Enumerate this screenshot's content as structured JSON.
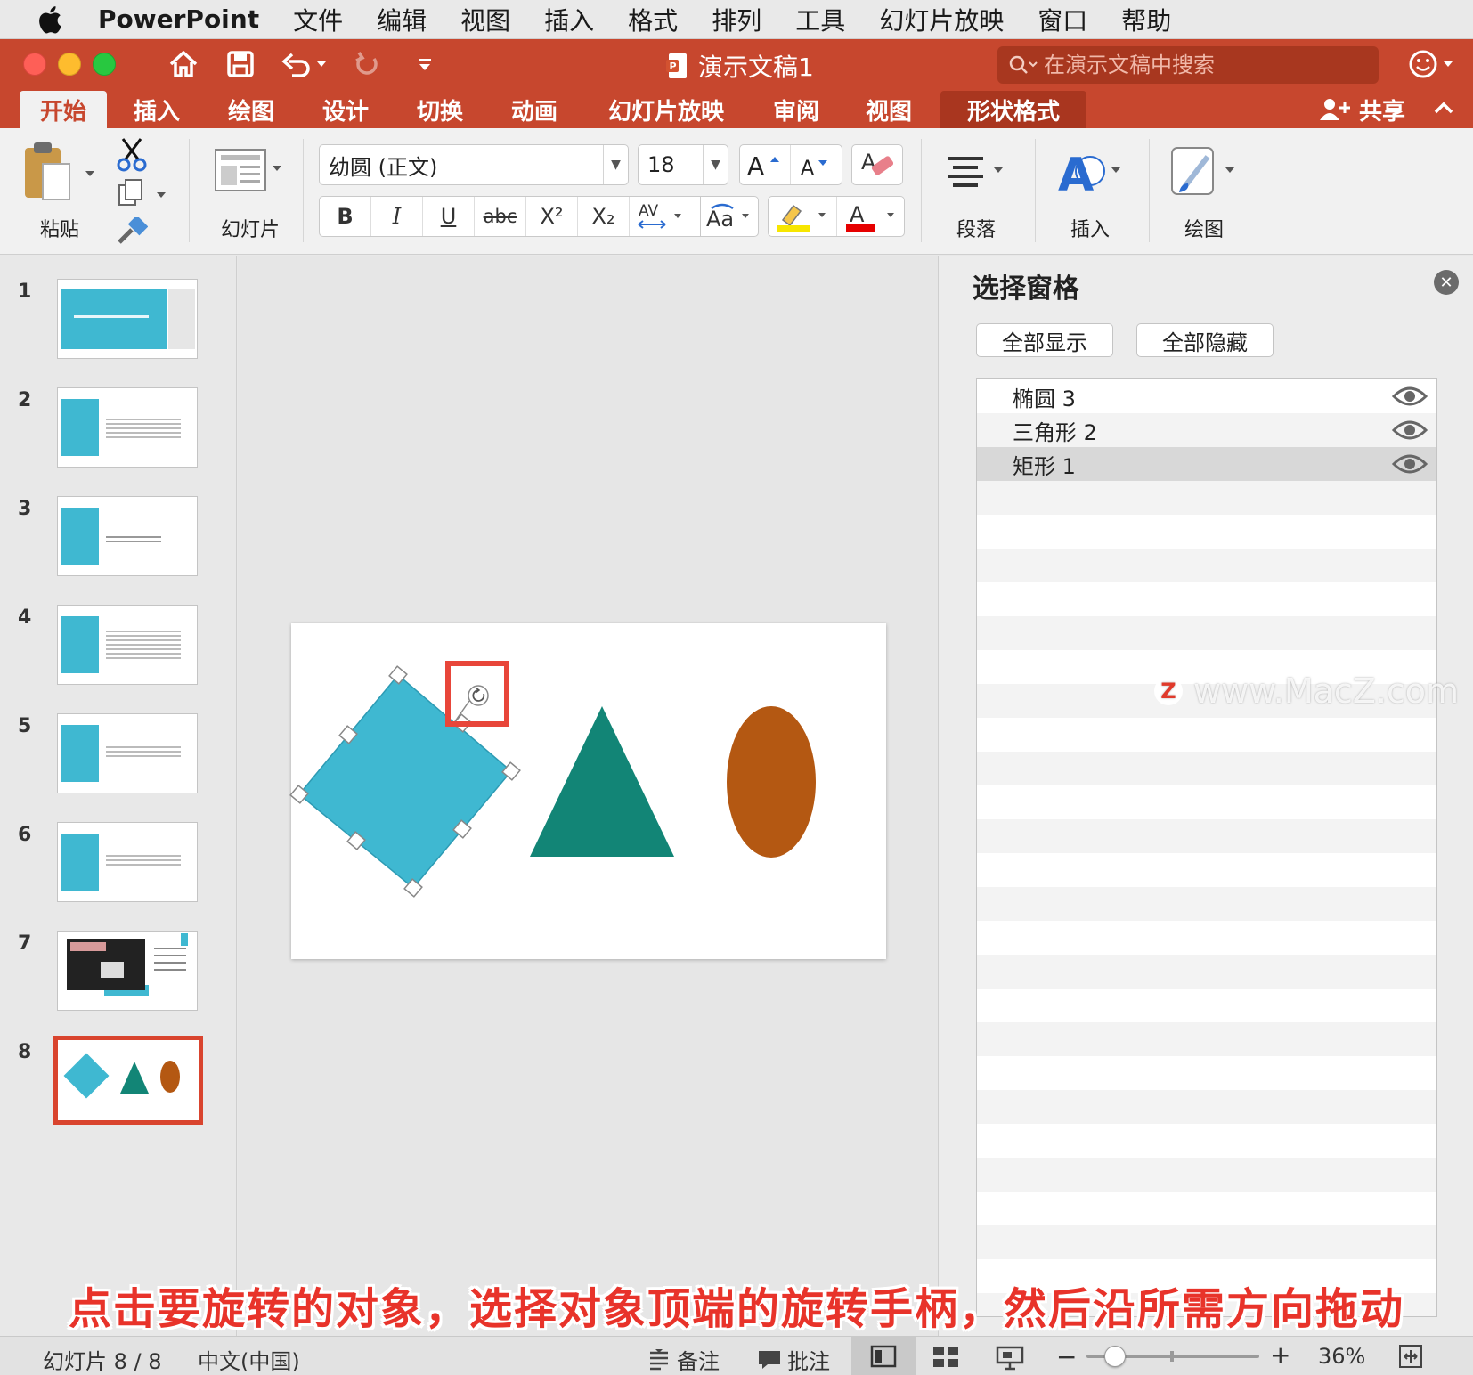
{
  "menubar": {
    "app": "PowerPoint",
    "items": [
      "文件",
      "编辑",
      "视图",
      "插入",
      "格式",
      "排列",
      "工具",
      "幻灯片放映",
      "窗口",
      "帮助"
    ]
  },
  "titlebar": {
    "doc_title": "演示文稿1",
    "search_placeholder": "在演示文稿中搜索"
  },
  "tabs": {
    "items": [
      "开始",
      "插入",
      "绘图",
      "设计",
      "切换",
      "动画",
      "幻灯片放映",
      "审阅",
      "视图",
      "形状格式"
    ],
    "active": "开始",
    "share_label": "共享"
  },
  "ribbon": {
    "paste_label": "粘贴",
    "slide_label": "幻灯片",
    "font_name": "幼圆 (正文)",
    "font_size": "18",
    "paragraph_label": "段落",
    "insert_label": "插入",
    "draw_label": "绘图",
    "format_buttons": [
      "B",
      "I",
      "U",
      "abc",
      "X²",
      "X₂"
    ],
    "colors": {
      "highlight": "#f7e600",
      "font_color": "#e60000",
      "accent": "#c7472e"
    }
  },
  "thumbnails": {
    "numbers": [
      "1",
      "2",
      "3",
      "4",
      "5",
      "6",
      "7",
      "8"
    ],
    "selected": 8
  },
  "slide": {
    "shapes": [
      {
        "name": "矩形 1",
        "color": "#3fb8d1"
      },
      {
        "name": "三角形 2",
        "color": "#128576"
      },
      {
        "name": "椭圆 3",
        "color": "#b45812"
      }
    ]
  },
  "pane": {
    "title": "选择窗格",
    "show_all": "全部显示",
    "hide_all": "全部隐藏",
    "items": [
      "椭圆 3",
      "三角形 2",
      "矩形 1"
    ],
    "selected": "矩形 1"
  },
  "watermark": "www.MacZ.com",
  "caption": "点击要旋转的对象，选择对象顶端的旋转手柄，然后沿所需方向拖动",
  "status": {
    "slide_counter": "幻灯片 8 / 8",
    "language": "中文(中国)",
    "notes_label": "备注",
    "comments_label": "批注",
    "zoom": "36%"
  }
}
